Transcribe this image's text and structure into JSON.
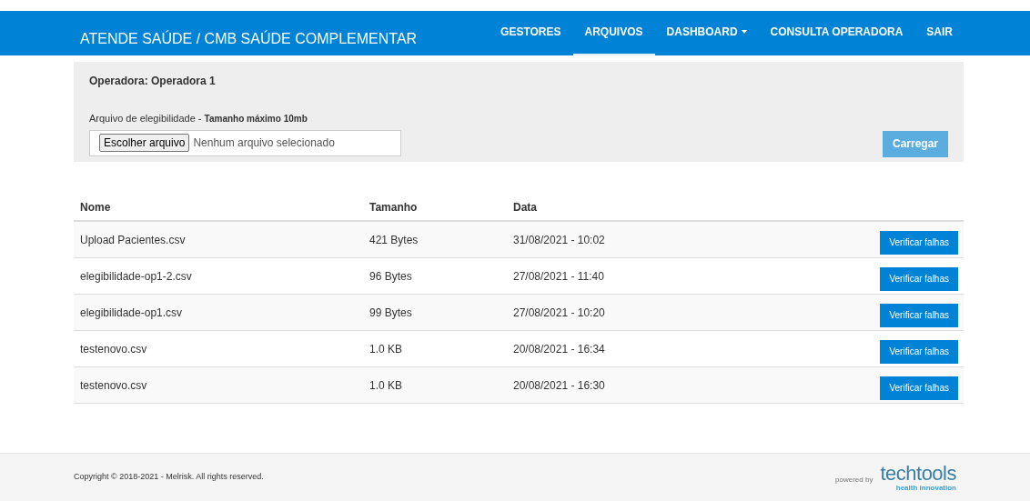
{
  "navbar": {
    "brand": "ATENDE SAÚDE / CMB SAÚDE COMPLEMENTAR",
    "items": [
      {
        "label": "GESTORES",
        "selected": false,
        "dropdown": false
      },
      {
        "label": "ARQUIVOS",
        "selected": true,
        "dropdown": false
      },
      {
        "label": "DASHBOARD",
        "selected": false,
        "dropdown": true
      },
      {
        "label": "CONSULTA OPERADORA",
        "selected": false,
        "dropdown": false
      },
      {
        "label": "SAIR",
        "selected": false,
        "dropdown": false
      }
    ]
  },
  "upload": {
    "operator": "Operadora: Operadora 1",
    "label": "Arquivo de elegibilidade - ",
    "hint": "Tamanho máximo 10mb",
    "choose_button": "Escolher arquivo",
    "file_status": "Nenhum arquivo selecionado",
    "submit_button": "Carregar"
  },
  "table": {
    "columns": [
      "Nome",
      "Tamanho",
      "Data"
    ],
    "rows": [
      {
        "name": "Upload Pacientes.csv",
        "size": "421 Bytes",
        "date": "31/08/2021 - 10:02",
        "action": "Verificar falhas"
      },
      {
        "name": "elegibilidade-op1-2.csv",
        "size": "96 Bytes",
        "date": "27/08/2021 - 11:40",
        "action": "Verificar falhas"
      },
      {
        "name": "elegibilidade-op1.csv",
        "size": "99 Bytes",
        "date": "27/08/2021 - 10:20",
        "action": "Verificar falhas"
      },
      {
        "name": "testenovo.csv",
        "size": "1.0 KB",
        "date": "20/08/2021 - 16:34",
        "action": "Verificar falhas"
      },
      {
        "name": "testenovo.csv",
        "size": "1.0 KB",
        "date": "20/08/2021 - 16:30",
        "action": "Verificar falhas"
      }
    ]
  },
  "footer": {
    "copyright": "Copyright © 2018-2021 - Melrisk. All rights reserved.",
    "powered_by": "powered by",
    "logo": "techtools",
    "logo_tagline": "health innovation"
  }
}
